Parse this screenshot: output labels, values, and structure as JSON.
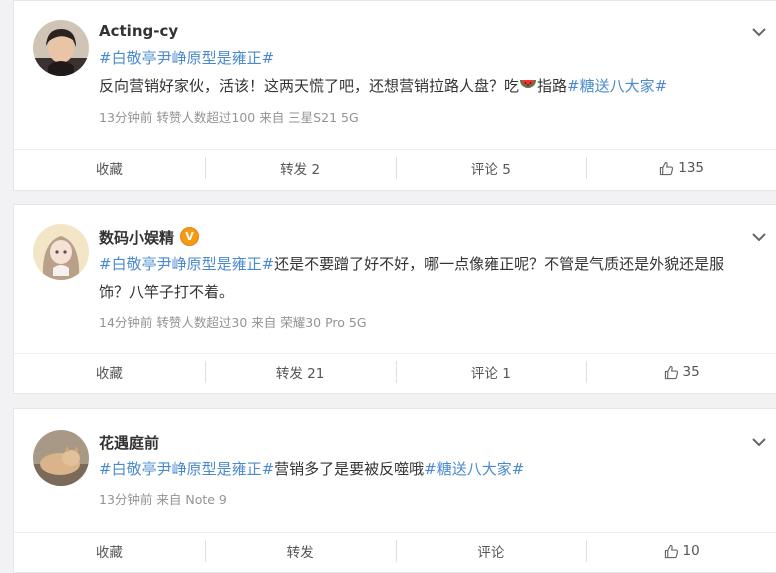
{
  "posts": [
    {
      "username": "Acting-cy",
      "hashtag1": "#白敬亭尹峥原型是雍正#",
      "body1": "反向营销好家伙，活该！这两天慌了吧，还想营销拉路人盘？吃",
      "body2": "指路",
      "hashtag2": "#糖送八大家#",
      "meta": "13分钟前  转赞人数超过100  来自 三星S21 5G",
      "actions": {
        "favorite": "收藏",
        "repost": "转发 2",
        "comment": "评论 5",
        "like": "135"
      }
    },
    {
      "username": "数码小娱精",
      "hashtag1": "#白敬亭尹峥原型是雍正#",
      "body1": "还是不要蹭了好不好，哪一点像雍正呢？不管是气质还是外貌还是服",
      "body2": "饰？八竿子打不着。",
      "meta": "14分钟前  转赞人数超过30  来自 荣耀30 Pro 5G",
      "actions": {
        "favorite": "收藏",
        "repost": "转发 21",
        "comment": "评论 1",
        "like": "35"
      }
    },
    {
      "username": "花遇庭前",
      "hashtag1": "#白敬亭尹峥原型是雍正#",
      "body1": "营销多了是要被反噬哦",
      "hashtag2": "#糖送八大家#",
      "meta": "13分钟前  来自 Note 9",
      "actions": {
        "favorite": "收藏",
        "repost": "转发",
        "comment": "评论",
        "like": "10"
      }
    }
  ],
  "colors": {
    "hashtag": "#4a8ad0",
    "verified_badge": "#f39c12"
  },
  "icons": [
    "chevron-down-icon",
    "thumbs-up-icon",
    "watermelon-emoji-icon",
    "verified-badge-icon"
  ]
}
